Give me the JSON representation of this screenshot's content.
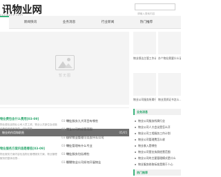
{
  "header": {
    "logo_main": "讯物业网",
    "logo_sub": "xunwuye.com",
    "search_placeholder": "请输入搜索内容"
  },
  "nav": {
    "items": [
      {
        "label": "新闻快讯",
        "active": false
      },
      {
        "label": "业务消息",
        "active": false
      },
      {
        "label": "行业新闻",
        "active": false
      },
      {
        "label": "热门推荐",
        "active": false
      }
    ]
  },
  "banner": {
    "placeholder_text": "暂无图",
    "caption": "物业的作用和职责",
    "counter": "05/05"
  },
  "hot": {
    "items": [
      {
        "caption": "物业保洁主管工作计划..."
      },
      {
        "caption": "办个物业需要什么证..."
      },
      {
        "caption": "物业公司服务合同范本..."
      },
      {
        "caption": "物业公司的经营范围..."
      },
      {
        "caption": "物业服务企业资质等级..."
      },
      {
        "caption": "小区物业管理费标准..."
      }
    ],
    "visible": [
      {
        "caption": "物业保洁主管工作计..."
      },
      {
        "caption": "办个物业需要什么证..."
      },
      {
        "caption": "物业公司服务所属行..."
      },
      {
        "caption": "物业资质证书怎么..."
      }
    ]
  },
  "featured": [
    {
      "title": "物业费包含什么费用[03-09]",
      "desc": "物业费包含物业公司人员工资、物业公共部位及设施设备的维修养护费、绿化费等..."
    },
    {
      "title": "物业服务方案内容是哪些[03-09]",
      "desc": "物业服务方案内容包括物业管理服务方案、物业管理服务的整体设想..."
    }
  ],
  "mid_list": [
    {
      "text": "物业服务九大项目有哪些",
      "date": "03-09"
    },
    {
      "text": "物业公司的经营范围",
      "date": "03-09"
    },
    {
      "text": "自学物业管理可以去什么公司",
      "date": "03-09"
    },
    {
      "text": "物业管理有什么专业",
      "date": "03-09"
    },
    {
      "text": "物业服务包括哪些",
      "date": "03-09"
    },
    {
      "text": "智慧物业公司如何开展物业",
      "date": "03-09"
    }
  ],
  "sidebar": {
    "business_head": "业务消息",
    "business_items": [
      "物业公司服务所属行业",
      "物业公司人大会议是怎么开",
      "物业公司工程服务工作计划",
      "物业公司管理费怎么收",
      "物业收入是哪些",
      "物业公司营业执照经营范围",
      "物业公司的主要管理模式是什么",
      "物业服务收取标准是属于人心"
    ],
    "hot_head": "热门推荐"
  }
}
